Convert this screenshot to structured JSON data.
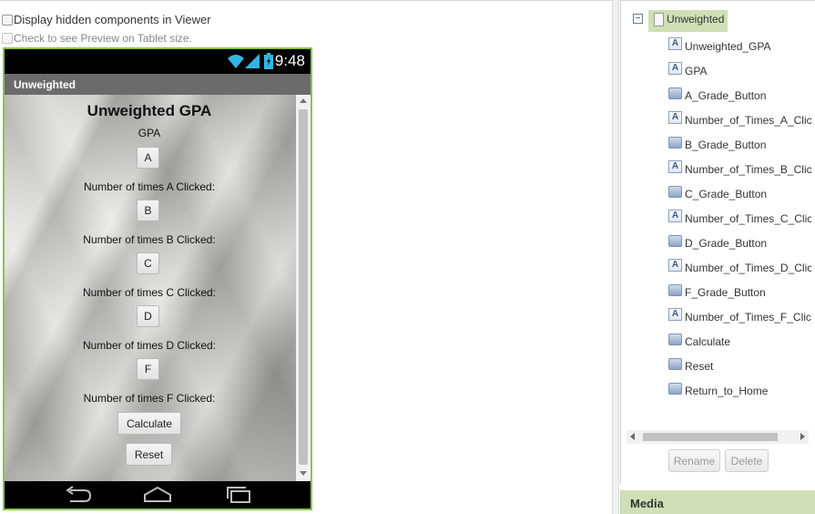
{
  "viewer": {
    "display_hidden_label": "Display hidden components in Viewer",
    "tablet_preview_label": "Check to see Preview on Tablet size."
  },
  "phone": {
    "status_time": "9:48",
    "screen_title": "Unweighted",
    "app_title": "Unweighted GPA",
    "gpa_label": "GPA",
    "rows": [
      {
        "button": "A",
        "count_label": "Number of times A Clicked:"
      },
      {
        "button": "B",
        "count_label": "Number of times B Clicked:"
      },
      {
        "button": "C",
        "count_label": "Number of times C Clicked:"
      },
      {
        "button": "D",
        "count_label": "Number of times D Clicked:"
      },
      {
        "button": "F",
        "count_label": "Number of times F Clicked:"
      }
    ],
    "calculate_button": "Calculate",
    "reset_button": "Reset"
  },
  "components": {
    "root": "Unweighted",
    "toggle": "−",
    "items": [
      {
        "label": "Unweighted_GPA",
        "icon": "label-icon"
      },
      {
        "label": "GPA",
        "icon": "label-icon"
      },
      {
        "label": "A_Grade_Button",
        "icon": "button-icon"
      },
      {
        "label": "Number_of_Times_A_Clicked",
        "icon": "label-icon"
      },
      {
        "label": "B_Grade_Button",
        "icon": "button-icon"
      },
      {
        "label": "Number_of_Times_B_Clicked",
        "icon": "label-icon"
      },
      {
        "label": "C_Grade_Button",
        "icon": "button-icon"
      },
      {
        "label": "Number_of_Times_C_Clicked",
        "icon": "label-icon"
      },
      {
        "label": "D_Grade_Button",
        "icon": "button-icon"
      },
      {
        "label": "Number_of_Times_D_Clicked",
        "icon": "label-icon"
      },
      {
        "label": "F_Grade_Button",
        "icon": "button-icon"
      },
      {
        "label": "Number_of_Times_F_Clicked",
        "icon": "label-icon"
      },
      {
        "label": "Calculate",
        "icon": "button-icon"
      },
      {
        "label": "Reset",
        "icon": "button-icon"
      },
      {
        "label": "Return_to_Home",
        "icon": "button-icon"
      }
    ],
    "rename_button": "Rename",
    "delete_button": "Delete",
    "label_icon_glyph": "A"
  },
  "media": {
    "title": "Media"
  },
  "colors": {
    "phone_border": "#8bc34a",
    "tree_selected": "#d0dfb5",
    "titlebar": "#6b6b6b"
  }
}
